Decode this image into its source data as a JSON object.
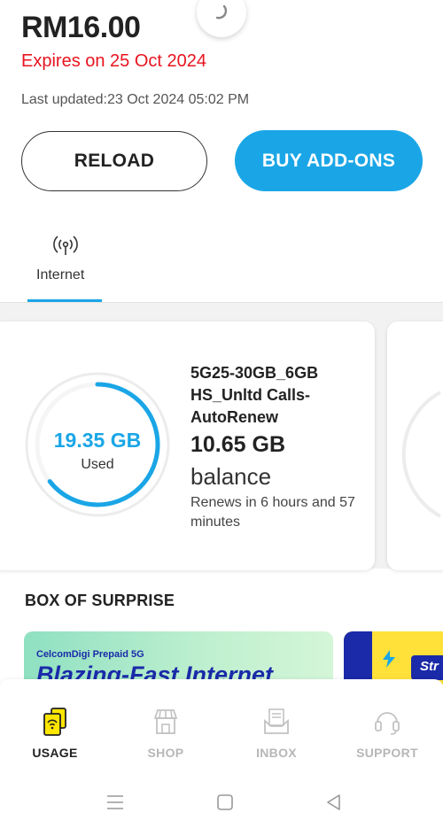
{
  "header": {
    "balance": "RM16.00",
    "expiry": "Expires on 25 Oct 2024",
    "last_updated": "Last updated:23 Oct 2024 05:02 PM"
  },
  "actions": {
    "reload_label": "RELOAD",
    "addons_label": "BUY ADD-ONS"
  },
  "tabs": [
    {
      "label": "Internet",
      "icon": "antenna-icon",
      "active": true
    }
  ],
  "usage": {
    "used_value": "19.35 GB",
    "used_label": "Used",
    "used_fraction": 0.645,
    "plan_name": "5G25-30GB_6GB HS_Unltd Calls-AutoRenew",
    "balance_value": "10.65 GB",
    "balance_label": "balance",
    "renews": "Renews in 6 hours and 57 minutes"
  },
  "promos": {
    "section_title": "BOX OF SURPRISE",
    "banner1_brand": "CelcomDigi Prepaid 5G",
    "banner1_headline": "Blazing-Fast Internet",
    "banner2_tag": "Str"
  },
  "bottom_nav": [
    {
      "label": "USAGE",
      "icon": "sim-card-icon",
      "active": true
    },
    {
      "label": "SHOP",
      "icon": "store-icon",
      "active": false
    },
    {
      "label": "INBOX",
      "icon": "inbox-icon",
      "active": false
    },
    {
      "label": "SUPPORT",
      "icon": "headset-icon",
      "active": false
    }
  ],
  "colors": {
    "accent": "#1aa6e6",
    "expiry_red": "#e8141f",
    "active_icon_yellow": "#ffe600"
  }
}
